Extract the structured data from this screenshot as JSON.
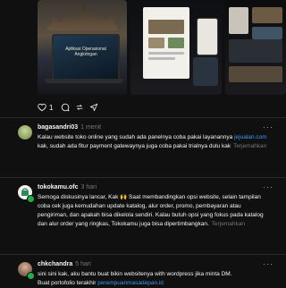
{
  "post_images": {
    "laptop_caption": "Aplikasi Operasional Angkringan"
  },
  "actions": {
    "like_icon": "heart-outline-icon",
    "like_count": "1",
    "reply_icon": "comment-bubble-icon",
    "repost_icon": "repost-icon",
    "share_icon": "send-icon"
  },
  "comments": [
    {
      "username": "bagasandri03",
      "time": "1 menit",
      "text_before_link": "Kalau website toko online yang sudah ada panelnya coba pakai layanannya ",
      "link": "jejualan.com",
      "text_after_link": " kak, sudah ada fitur payment gatewaynya juga coba pakai trialnya dulu kak",
      "translate": "Terjemahkan",
      "more": "···"
    },
    {
      "username": "tokokamu.ofc",
      "time": "3 hari",
      "text": "Semoga diskusinya lancar, Kak 🙌 Saat membandingkan opsi website, selain tampilan coba cek juga kemudahan update katalog, alur order, promo, pembayaran atau pengiriman, dan apakah bisa dikelola sendiri. Kalau butuh opsi yang fokus pada katalog dan alur order yang ringkas, Tokokamu juga bisa dipertimbangkan.",
      "translate": "Terjemahkan",
      "more": "···"
    },
    {
      "username": "chkchandra",
      "time": "5 hari",
      "text_line1": "sini sini kak, aku bantu buat bikin websitenya with wordpress jika minta DM.",
      "text_before_link": "Buat portofolio terakhir ",
      "link": "perempuanmasadepan.id",
      "more": "···"
    }
  ]
}
